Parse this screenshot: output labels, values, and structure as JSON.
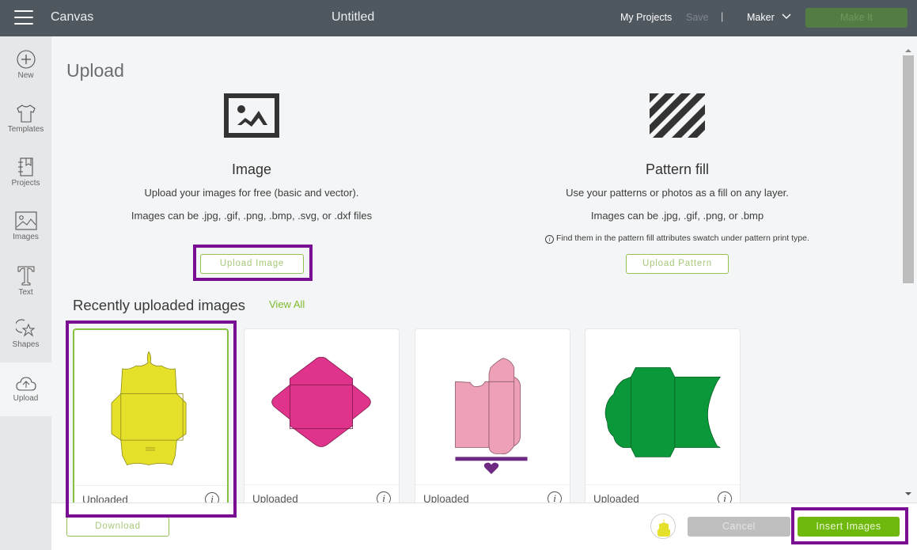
{
  "topbar": {
    "app_name": "Canvas",
    "document_title": "Untitled",
    "my_projects": "My Projects",
    "save": "Save",
    "separator": "|",
    "machine": "Maker",
    "make_it": "Make It"
  },
  "sidebar": {
    "items": [
      {
        "label": "New",
        "icon": "plus-circle-icon"
      },
      {
        "label": "Templates",
        "icon": "tshirt-icon"
      },
      {
        "label": "Projects",
        "icon": "notebook-icon"
      },
      {
        "label": "Images",
        "icon": "image-icon"
      },
      {
        "label": "Text",
        "icon": "text-t-icon"
      },
      {
        "label": "Shapes",
        "icon": "shapes-icon"
      },
      {
        "label": "Upload",
        "icon": "cloud-upload-icon",
        "active": true
      }
    ]
  },
  "main": {
    "page_title": "Upload",
    "image_panel": {
      "title": "Image",
      "description": "Upload your images for free (basic and vector).",
      "formats": "Images can be .jpg, .gif, .png, .bmp, .svg, or .dxf files",
      "button": "Upload Image"
    },
    "pattern_panel": {
      "title": "Pattern fill",
      "description": "Use your patterns or photos as a fill on any layer.",
      "formats": "Images can be .jpg, .gif, .png, or .bmp",
      "note": "Find them in the pattern fill attributes swatch under pattern print type.",
      "button": "Upload Pattern"
    },
    "recent": {
      "title": "Recently uploaded images",
      "view_all": "View All",
      "cards": [
        {
          "status": "Uploaded",
          "color": "#e5e02a",
          "selected": true
        },
        {
          "status": "Uploaded",
          "color": "#e0338c",
          "selected": false
        },
        {
          "status": "Uploaded",
          "color": "#eea1b6",
          "selected": false
        },
        {
          "status": "Uploaded",
          "color": "#0b983a",
          "selected": false
        }
      ]
    }
  },
  "footer": {
    "download": "Download",
    "cancel": "Cancel",
    "insert": "Insert Images"
  },
  "colors": {
    "accent_green": "#6fb80d",
    "highlight_purple": "#7a0e93",
    "topbar_bg": "#4f575f"
  }
}
